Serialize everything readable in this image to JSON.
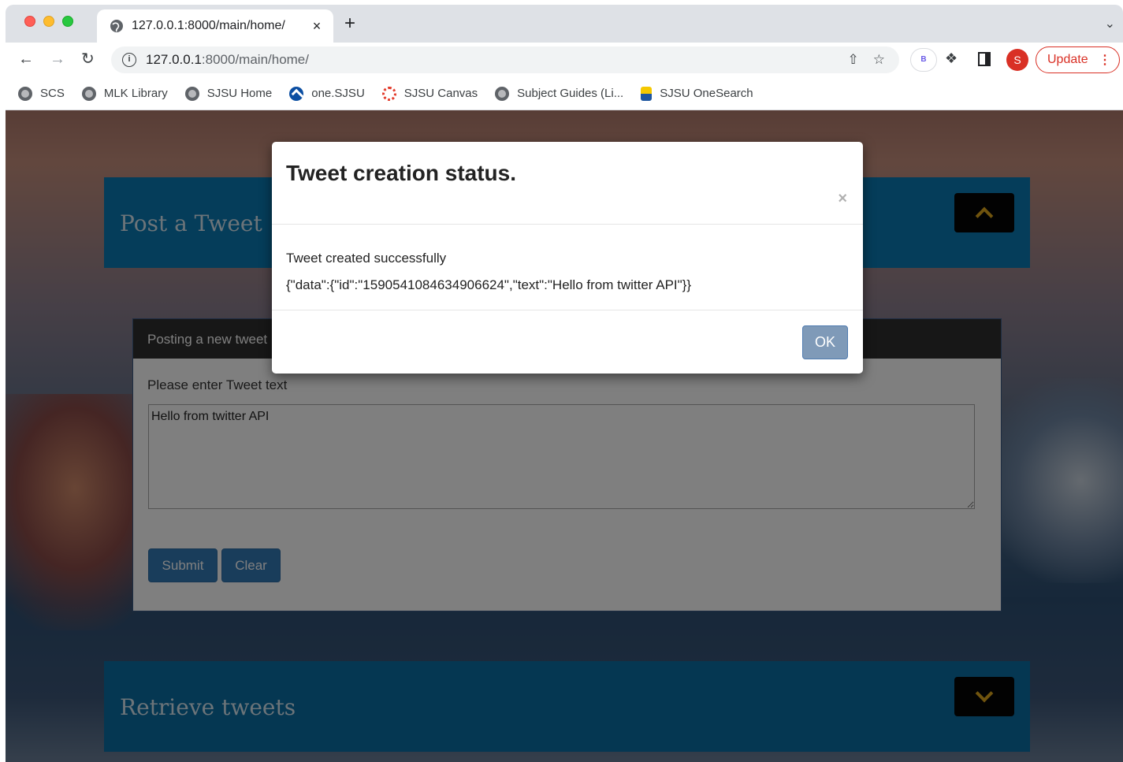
{
  "browser": {
    "tab_title": "127.0.0.1:8000/main/home/",
    "tab_close": "×",
    "new_tab": "+",
    "tab_menu": "⌄",
    "url_host": "127.0.0.1",
    "url_path": ":8000/main/home/",
    "info_glyph": "i",
    "extension_label": "B",
    "avatar_letter": "S",
    "update_label": "Update",
    "bookmarks": [
      {
        "label": "SCS",
        "icon": "world-icon"
      },
      {
        "label": "MLK Library",
        "icon": "world-icon"
      },
      {
        "label": "SJSU Home",
        "icon": "world-icon"
      },
      {
        "label": "one.SJSU",
        "icon": "onesjsu-icon"
      },
      {
        "label": "SJSU Canvas",
        "icon": "canvas-icon"
      },
      {
        "label": "Subject Guides (Li...",
        "icon": "world-icon"
      },
      {
        "label": "SJSU OneSearch",
        "icon": "onesearch-icon"
      }
    ]
  },
  "page": {
    "post_section_title": "Post a Tweet",
    "retrieve_section_title": "Retrieve tweets",
    "card_header": "Posting a new tweet",
    "input_label": "Please enter Tweet text",
    "tweet_text": "Hello from twitter API",
    "submit_label": "Submit",
    "clear_label": "Clear"
  },
  "modal": {
    "title": "Tweet creation status.",
    "close_glyph": "×",
    "message": "Tweet created successfully",
    "response_json": "{\"data\":{\"id\":\"1590541084634906624\",\"text\":\"Hello from twitter API\"}}",
    "ok_label": "OK"
  },
  "colors": {
    "section_header": "#0a7ab4",
    "chevron": "#e0a81c",
    "primary_button": "#337ab7",
    "update_accent": "#d93025"
  }
}
